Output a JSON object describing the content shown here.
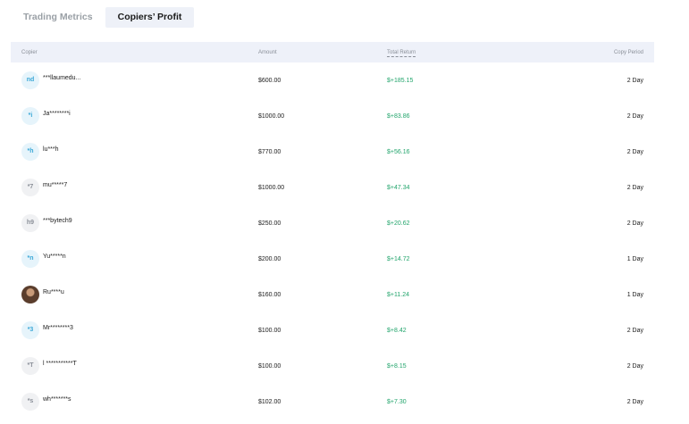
{
  "tabs": [
    {
      "label": "Trading Metrics",
      "active": false
    },
    {
      "label": "Copiers’ Profit",
      "active": true
    }
  ],
  "table": {
    "headers": {
      "copier": "Copier",
      "amount": "Amount",
      "total_return": "Total Return",
      "copy_period": "Copy Period"
    },
    "rows": [
      {
        "avatar": "nd",
        "avatar_style": "blue",
        "name": "***llaumedu...",
        "amount": "$600.00",
        "total_return": "$+185.15",
        "copy_period": "2 Day"
      },
      {
        "avatar": "*i",
        "avatar_style": "blue",
        "name": "Ja********i",
        "amount": "$1000.00",
        "total_return": "$+83.86",
        "copy_period": "2 Day"
      },
      {
        "avatar": "*h",
        "avatar_style": "blue",
        "name": "lu***h",
        "amount": "$770.00",
        "total_return": "$+56.16",
        "copy_period": "2 Day"
      },
      {
        "avatar": "*7",
        "avatar_style": "gray",
        "name": "mu*****7",
        "amount": "$1000.00",
        "total_return": "$+47.34",
        "copy_period": "2 Day"
      },
      {
        "avatar": "h9",
        "avatar_style": "gray",
        "name": "***bytech9",
        "amount": "$250.00",
        "total_return": "$+20.62",
        "copy_period": "2 Day"
      },
      {
        "avatar": "*n",
        "avatar_style": "blue",
        "name": "Yu*****n",
        "amount": "$200.00",
        "total_return": "$+14.72",
        "copy_period": "1 Day"
      },
      {
        "avatar": "",
        "avatar_style": "photo",
        "name": "Ru****u",
        "amount": "$160.00",
        "total_return": "$+11.24",
        "copy_period": "1 Day"
      },
      {
        "avatar": "*3",
        "avatar_style": "blue",
        "name": "Mr********3",
        "amount": "$100.00",
        "total_return": "$+8.42",
        "copy_period": "2 Day"
      },
      {
        "avatar": "*T",
        "avatar_style": "gray",
        "name": "l ***********T",
        "amount": "$100.00",
        "total_return": "$+8.15",
        "copy_period": "2 Day"
      },
      {
        "avatar": "*s",
        "avatar_style": "gray",
        "name": "wh*******s",
        "amount": "$102.00",
        "total_return": "$+7.30",
        "copy_period": "2 Day"
      }
    ]
  },
  "colors": {
    "positive_return": "#21a46b",
    "header_bg": "#eef1f9",
    "avatar_blue": "#3aa7d6"
  }
}
